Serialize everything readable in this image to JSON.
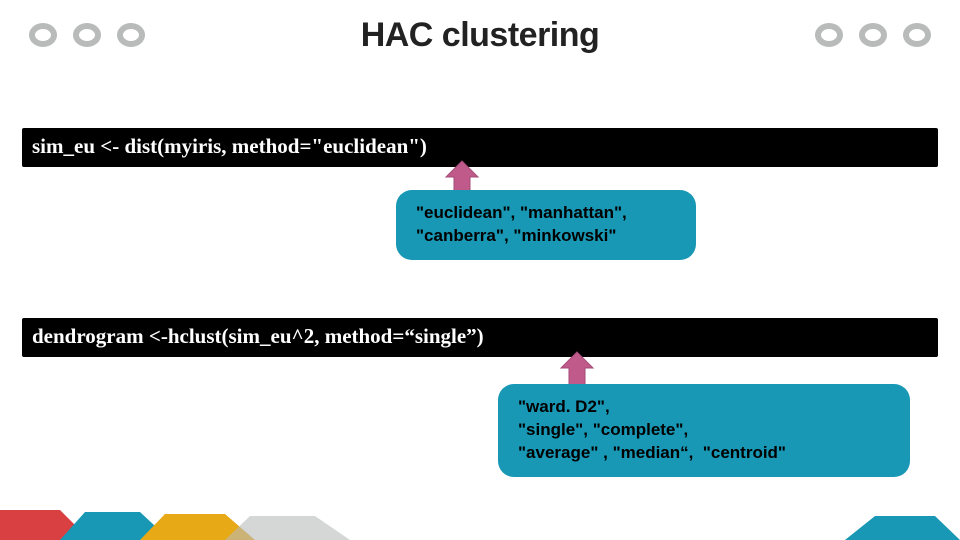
{
  "title": "HAC clustering",
  "code_lines": {
    "dist": "sim_eu <- dist(myiris,  method=\"euclidean\")",
    "hclust": "dendrogram <-hclust(sim_eu^2,  method=“single”)"
  },
  "callouts": {
    "dist_methods": "\"euclidean\", \"manhattan\", \"canberra\", \"minkowski\"",
    "hclust_methods": "\"ward. D2\",\n\"single\", \"complete\",\n\"average\" , \"median“,  \"centroid\""
  },
  "colors": {
    "accent_teal": "#1898b5",
    "accent_red": "#d94042",
    "accent_amber": "#e7a915",
    "arrow_fill": "#c05a8a",
    "ooo_stroke": "#b9bbba"
  }
}
